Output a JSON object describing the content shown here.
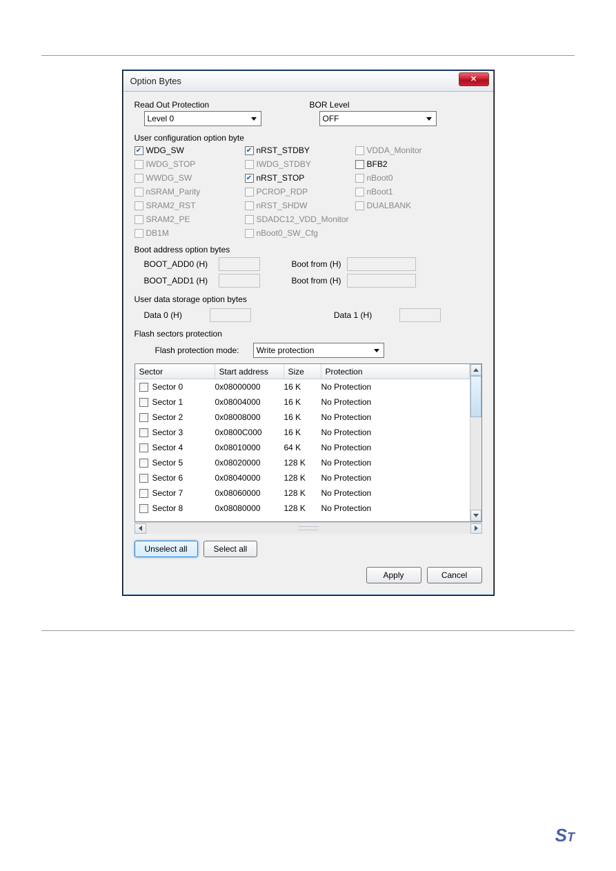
{
  "dialog": {
    "title": "Option Bytes",
    "readout": {
      "label": "Read Out Protection",
      "value": "Level 0"
    },
    "bor": {
      "label": "BOR Level",
      "value": "OFF"
    },
    "userconfig": {
      "label": "User configuration option byte",
      "items": [
        {
          "name": "WDG_SW",
          "checked": true,
          "enabled": true
        },
        {
          "name": "nRST_STDBY",
          "checked": true,
          "enabled": true
        },
        {
          "name": "VDDA_Monitor",
          "checked": false,
          "enabled": false
        },
        {
          "name": "IWDG_STOP",
          "checked": false,
          "enabled": false
        },
        {
          "name": "IWDG_STDBY",
          "checked": false,
          "enabled": false
        },
        {
          "name": "BFB2",
          "checked": false,
          "enabled": true
        },
        {
          "name": "WWDG_SW",
          "checked": false,
          "enabled": false
        },
        {
          "name": "nRST_STOP",
          "checked": true,
          "enabled": true
        },
        {
          "name": "nBoot0",
          "checked": false,
          "enabled": false
        },
        {
          "name": "nSRAM_Parity",
          "checked": false,
          "enabled": false
        },
        {
          "name": "PCROP_RDP",
          "checked": false,
          "enabled": false
        },
        {
          "name": "nBoot1",
          "checked": false,
          "enabled": false
        },
        {
          "name": "SRAM2_RST",
          "checked": false,
          "enabled": false
        },
        {
          "name": "nRST_SHDW",
          "checked": false,
          "enabled": false
        },
        {
          "name": "DUALBANK",
          "checked": false,
          "enabled": false
        },
        {
          "name": "SRAM2_PE",
          "checked": false,
          "enabled": false
        },
        {
          "name": "SDADC12_VDD_Monitor",
          "checked": false,
          "enabled": false,
          "span": 2
        },
        {
          "name": "DB1M",
          "checked": false,
          "enabled": false
        },
        {
          "name": "nBoot0_SW_Cfg",
          "checked": false,
          "enabled": false,
          "span": 2
        }
      ]
    },
    "boot": {
      "label": "Boot address option bytes",
      "add0": "BOOT_ADD0 (H)",
      "add1": "BOOT_ADD1 (H)",
      "from": "Boot from (H)"
    },
    "userdata": {
      "label": "User data storage option bytes",
      "d0": "Data 0 (H)",
      "d1": "Data 1 (H)"
    },
    "flash": {
      "label": "Flash sectors protection",
      "modeLabel": "Flash protection mode:",
      "modeValue": "Write protection",
      "headers": {
        "sector": "Sector",
        "start": "Start address",
        "size": "Size",
        "prot": "Protection"
      },
      "rows": [
        {
          "sector": "Sector 0",
          "start": "0x08000000",
          "size": "16 K",
          "prot": "No Protection"
        },
        {
          "sector": "Sector 1",
          "start": "0x08004000",
          "size": "16 K",
          "prot": "No Protection"
        },
        {
          "sector": "Sector 2",
          "start": "0x08008000",
          "size": "16 K",
          "prot": "No Protection"
        },
        {
          "sector": "Sector 3",
          "start": "0x0800C000",
          "size": "16 K",
          "prot": "No Protection"
        },
        {
          "sector": "Sector 4",
          "start": "0x08010000",
          "size": "64 K",
          "prot": "No Protection"
        },
        {
          "sector": "Sector 5",
          "start": "0x08020000",
          "size": "128 K",
          "prot": "No Protection"
        },
        {
          "sector": "Sector 6",
          "start": "0x08040000",
          "size": "128 K",
          "prot": "No Protection"
        },
        {
          "sector": "Sector 7",
          "start": "0x08060000",
          "size": "128 K",
          "prot": "No Protection"
        },
        {
          "sector": "Sector 8",
          "start": "0x08080000",
          "size": "128 K",
          "prot": "No Protection"
        }
      ]
    },
    "buttons": {
      "unselect": "Unselect all",
      "select": "Select all",
      "apply": "Apply",
      "cancel": "Cancel"
    }
  }
}
